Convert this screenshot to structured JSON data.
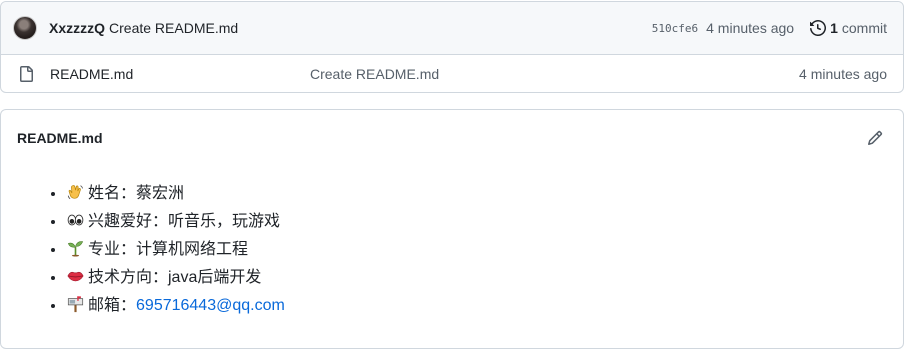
{
  "commit": {
    "author": "XxzzzzQ",
    "message": "Create README.md",
    "sha": "510cfe6",
    "time": "4 minutes ago",
    "count": "1",
    "count_label": "commit"
  },
  "files": [
    {
      "name": "README.md",
      "last_commit": "Create README.md",
      "time": "4 minutes ago"
    }
  ],
  "readme": {
    "title": "README.md",
    "items": [
      {
        "icon": "waving-hand-icon",
        "text": "姓名：蔡宏洲"
      },
      {
        "icon": "eyes-icon",
        "text": "兴趣爱好：听音乐，玩游戏"
      },
      {
        "icon": "seedling-icon",
        "text": "专业：计算机网络工程"
      },
      {
        "icon": "lips-icon",
        "text": "技术方向：java后端开发"
      },
      {
        "icon": "mailbox-icon",
        "label": "邮箱：",
        "email": "695716443@qq.com"
      }
    ]
  },
  "colors": {
    "link": "#0969da",
    "muted": "#57606a",
    "border": "#d0d7de",
    "header_bg": "#f6f8fa"
  }
}
